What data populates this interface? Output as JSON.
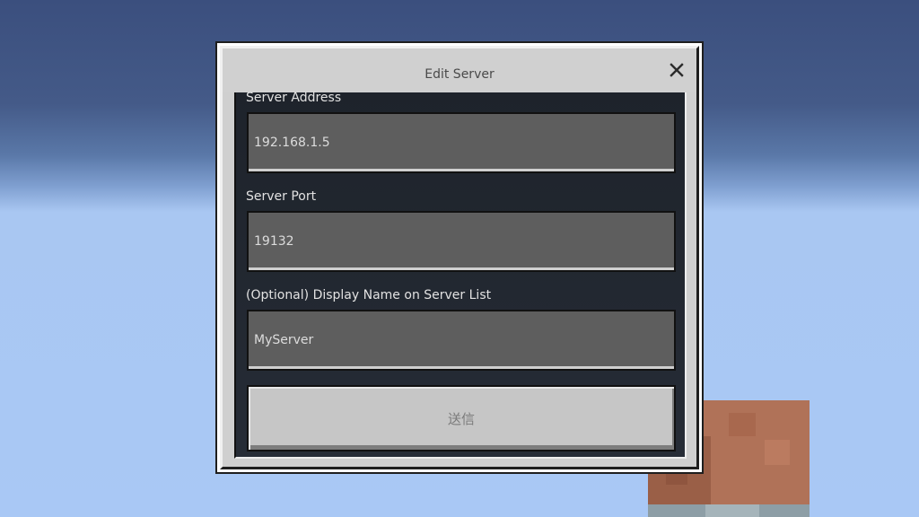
{
  "dialog": {
    "title": "Edit Server",
    "close_icon": "close-icon"
  },
  "form": {
    "server_address": {
      "label": "Server Address",
      "value": "192.168.1.5"
    },
    "server_port": {
      "label": "Server Port",
      "value": "19132"
    },
    "display_name": {
      "label": "(Optional) Display Name on Server List",
      "value": "MyServer"
    },
    "submit_label": "送信"
  },
  "colors": {
    "sky_top": "#3b4f7e",
    "sky_bottom": "#a9c8f5",
    "dialog_bg": "#cfcfcf",
    "content_bg": "#1e232b",
    "input_bg": "#5e5e5e",
    "button_bg": "#c6c6c6"
  }
}
